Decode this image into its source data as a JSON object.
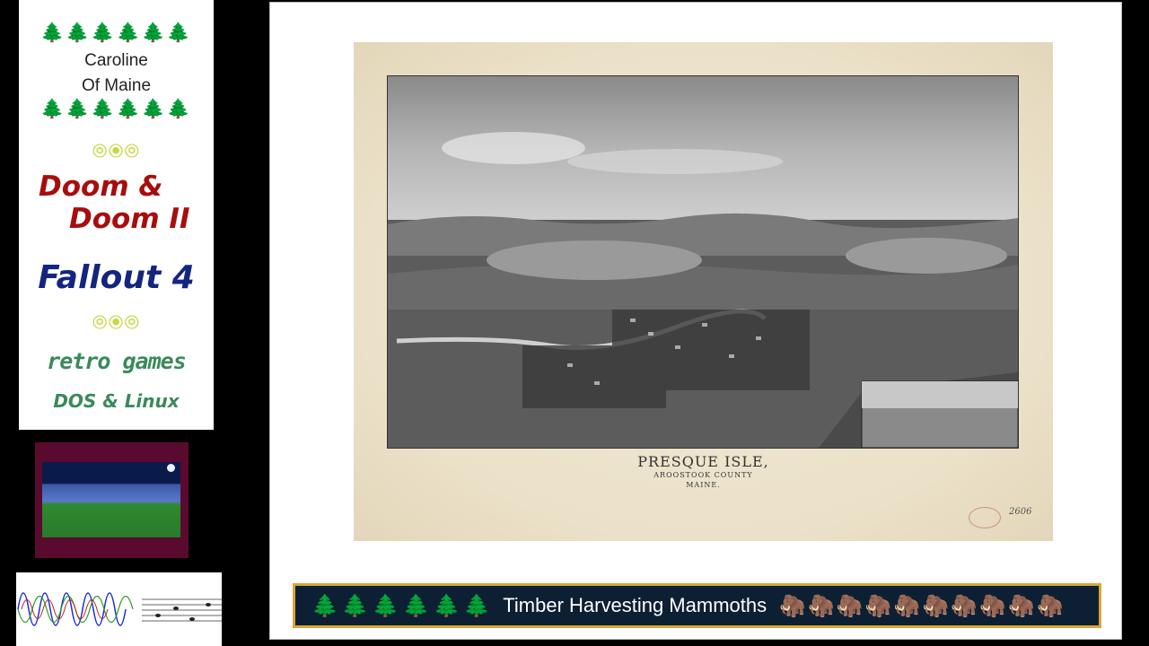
{
  "sidebar": {
    "trees_top": "🌲🌲🌲🌲🌲🌲",
    "name_line1": "Caroline",
    "name_line2": "Of Maine",
    "trees_bottom": "🌲🌲🌲🌲🌲🌲",
    "rings_1": "⦾⦿⦾",
    "doom_line1": "Doom &",
    "doom_line2": "Doom II",
    "fallout": "Fallout 4",
    "rings_2": "⦾⦿⦾",
    "retro": "retro games",
    "dos": "DOS & Linux"
  },
  "map": {
    "title": "PRESQUE ISLE,",
    "subtitle1": "AROOSTOOK COUNTY",
    "subtitle2": "MAINE.",
    "pencil_number": "2606"
  },
  "banner": {
    "trees": "🌲🌲🌲🌲🌲🌲",
    "text": "Timber Harvesting Mammoths",
    "mammoths": "🦣🦣🦣🦣🦣🦣🦣🦣🦣🦣"
  },
  "colors": {
    "doom": "#a80d0d",
    "fallout": "#142580",
    "retro": "#3a8a5a",
    "banner_bg": "#0d1f33",
    "banner_border": "#d9a637"
  }
}
